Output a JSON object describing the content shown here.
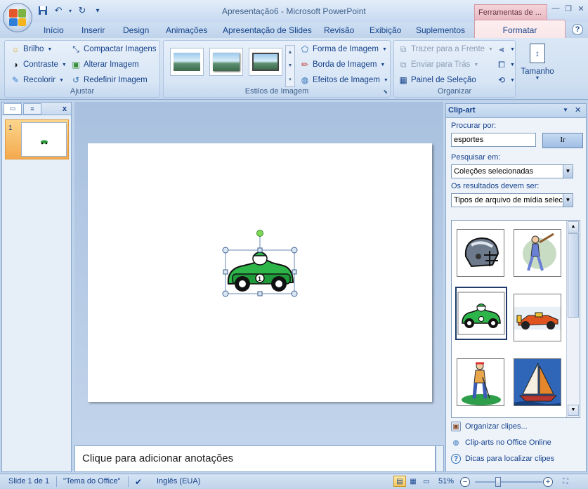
{
  "window": {
    "title": "Apresentação6 - Microsoft PowerPoint",
    "contextual_header": "Ferramentas de ...",
    "controls": {
      "minimize": "—",
      "restore": "❐",
      "close": "✕"
    }
  },
  "qat": {
    "customize": "▾"
  },
  "tabs": [
    "Início",
    "Inserir",
    "Design",
    "Animações",
    "Apresentação de Slides",
    "Revisão",
    "Exibição",
    "Suplementos"
  ],
  "active_tab": "Formatar",
  "ribbon": {
    "ajustar": {
      "label": "Ajustar",
      "brilho": "Brilho",
      "contraste": "Contraste",
      "recolorir": "Recolorir",
      "compactar": "Compactar Imagens",
      "alterar": "Alterar Imagem",
      "redefinir": "Redefinir Imagem"
    },
    "estilos": {
      "label": "Estilos de Imagem",
      "forma": "Forma de Imagem",
      "borda": "Borda de Imagem",
      "efeitos": "Efeitos de Imagem"
    },
    "organizar": {
      "label": "Organizar",
      "trazer": "Trazer para a Frente",
      "enviar": "Enviar para Trás",
      "painel": "Painel de Seleção"
    },
    "tamanho": {
      "label": "Tamanho"
    }
  },
  "slides_pane": {
    "slide_number": "1"
  },
  "notes": {
    "placeholder": "Clique para adicionar anotações"
  },
  "clipart": {
    "title": "Clip-art",
    "search_label": "Procurar por:",
    "search_value": "esportes",
    "go_button": "Ir",
    "search_in_label": "Pesquisar em:",
    "search_in_value": "Coleções selecionadas",
    "results_label": "Os resultados devem ser:",
    "results_value": "Tipos de arquivo de mídia selecion",
    "items": [
      "football-helmet",
      "baseball-player",
      "race-car",
      "formula-car",
      "golfer",
      "sailboat"
    ],
    "links": [
      "Organizar clipes...",
      "Clip-arts no Office Online",
      "Dicas para localizar clipes"
    ]
  },
  "status": {
    "slide": "Slide 1 de 1",
    "theme": "\"Tema do Office\"",
    "language": "Inglês (EUA)",
    "zoom": "51%",
    "zoom_fraction": 0.34
  },
  "colors": {
    "accent": "#15428b",
    "contextual": "#e7b7c0",
    "selection": "#f4a94e"
  }
}
